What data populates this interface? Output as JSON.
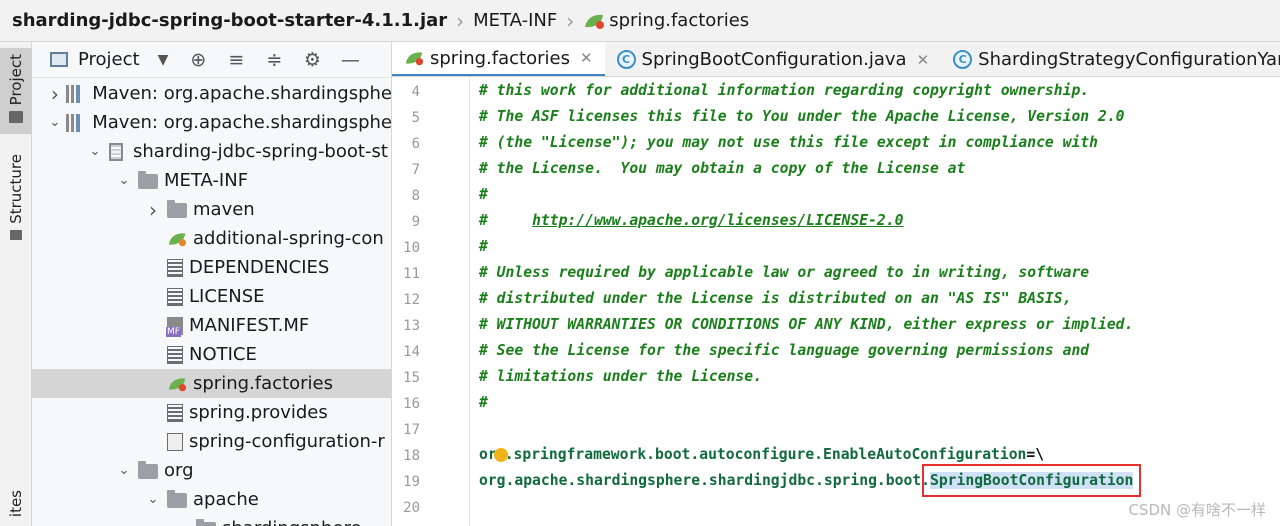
{
  "breadcrumb": [
    "sharding-jdbc-spring-boot-starter-4.1.1.jar",
    "META-INF",
    "spring.factories"
  ],
  "tool_stripe": {
    "project_label": "Project",
    "structure_label": "Structure",
    "bottom_label": "ites"
  },
  "project_panel": {
    "title": "Project",
    "tools": [
      "⊕",
      "≡",
      "≑",
      "⚙",
      "—"
    ],
    "tree": [
      {
        "label": "Maven: org.apache.shardingsphe",
        "icon": "library-icon",
        "expanded": false,
        "indent": 0
      },
      {
        "label": "Maven: org.apache.shardingsphe",
        "icon": "library-icon",
        "expanded": true,
        "indent": 0
      },
      {
        "label": "sharding-jdbc-spring-boot-st",
        "icon": "jar-icon",
        "expanded": true,
        "indent": 1
      },
      {
        "label": "META-INF",
        "icon": "folder-icon",
        "expanded": true,
        "indent": 2
      },
      {
        "label": "maven",
        "icon": "folder-icon",
        "expanded": false,
        "indent": 3
      },
      {
        "label": "additional-spring-con",
        "icon": "spring-config-icon",
        "expanded": null,
        "indent": 3
      },
      {
        "label": "DEPENDENCIES",
        "icon": "text-file-icon",
        "expanded": null,
        "indent": 3
      },
      {
        "label": "LICENSE",
        "icon": "text-file-icon",
        "expanded": null,
        "indent": 3
      },
      {
        "label": "MANIFEST.MF",
        "icon": "manifest-icon",
        "expanded": null,
        "indent": 3
      },
      {
        "label": "NOTICE",
        "icon": "text-file-icon",
        "expanded": null,
        "indent": 3
      },
      {
        "label": "spring.factories",
        "icon": "spring-leaf-icon",
        "expanded": null,
        "indent": 3,
        "selected": true
      },
      {
        "label": "spring.provides",
        "icon": "text-file-icon",
        "expanded": null,
        "indent": 3
      },
      {
        "label": "spring-configuration-r",
        "icon": "config-file-icon",
        "expanded": null,
        "indent": 3
      },
      {
        "label": "org",
        "icon": "folder-icon",
        "expanded": true,
        "indent": 2
      },
      {
        "label": "apache",
        "icon": "folder-icon",
        "expanded": true,
        "indent": 3
      },
      {
        "label": "shardingsphere",
        "icon": "folder-icon",
        "expanded": true,
        "indent": 4
      }
    ]
  },
  "tabs": [
    {
      "label": "spring.factories",
      "icon": "spring-leaf-icon",
      "active": true
    },
    {
      "label": "SpringBootConfiguration.java",
      "icon": "class-c-icon",
      "active": false
    },
    {
      "label": "ShardingStrategyConfigurationYamlSwa",
      "icon": "class-c-icon",
      "active": false
    }
  ],
  "editor": {
    "lines": [
      {
        "num": "4",
        "text": "# this work for additional information regarding copyright ownership.",
        "kind": "comment"
      },
      {
        "num": "5",
        "text": "# The ASF licenses this file to You under the Apache License, Version 2.0",
        "kind": "comment"
      },
      {
        "num": "6",
        "text": "# (the \"License\"); you may not use this file except in compliance with",
        "kind": "comment"
      },
      {
        "num": "7",
        "text": "# the License.  You may obtain a copy of the License at",
        "kind": "comment"
      },
      {
        "num": "8",
        "text": "#",
        "kind": "comment"
      },
      {
        "num": "9",
        "text": "#     ",
        "link": "http://www.apache.org/licenses/LICENSE-2.0",
        "kind": "comment-link"
      },
      {
        "num": "10",
        "text": "#",
        "kind": "comment"
      },
      {
        "num": "11",
        "text": "# Unless required by applicable law or agreed to in writing, software",
        "kind": "comment"
      },
      {
        "num": "12",
        "text": "# distributed under the License is distributed on an \"AS IS\" BASIS,",
        "kind": "comment"
      },
      {
        "num": "13",
        "text": "# WITHOUT WARRANTIES OR CONDITIONS OF ANY KIND, either express or implied.",
        "kind": "comment"
      },
      {
        "num": "14",
        "text": "# See the License for the specific language governing permissions and",
        "kind": "comment"
      },
      {
        "num": "15",
        "text": "# limitations under the License.",
        "kind": "comment"
      },
      {
        "num": "16",
        "text": "#",
        "kind": "comment"
      },
      {
        "num": "17",
        "text": "",
        "kind": "blank"
      },
      {
        "num": "18",
        "pre": "or",
        "text": ".springframework.boot.autoconfigure.EnableAutoConfiguration",
        "post": "=\\",
        "kind": "key"
      },
      {
        "num": "19",
        "text": "org.apache.shardingsphere.shardingjdbc.spring.boot.",
        "highlight": "SpringBootConfiguration",
        "kind": "value"
      },
      {
        "num": "20",
        "text": "",
        "kind": "blank"
      }
    ]
  },
  "watermark": "CSDN @有啥不一样",
  "colors": {
    "comment": "#1a7f1a",
    "property": "#106a3c",
    "selection": "#d5d5d5",
    "highlight_box": "#e63030"
  }
}
